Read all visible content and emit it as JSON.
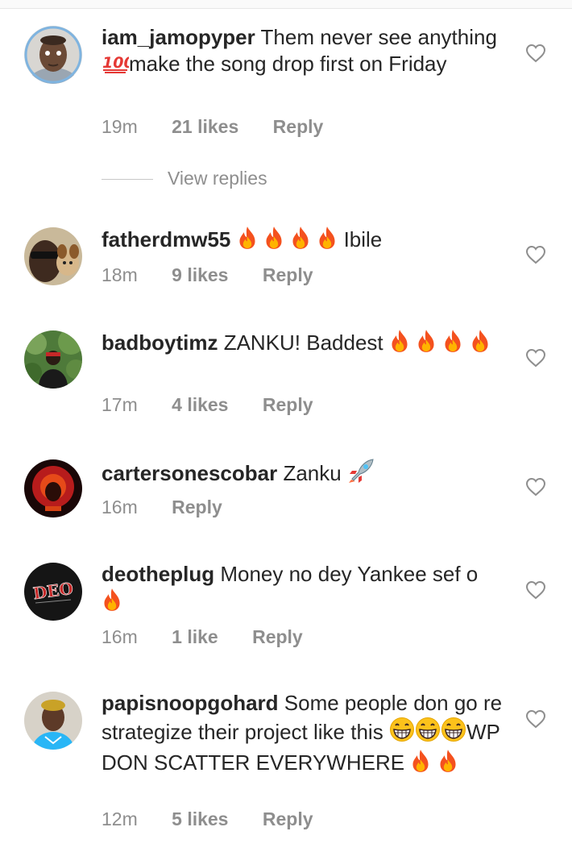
{
  "comments": [
    {
      "username": "iam_jamopyper",
      "text_parts": [
        "Them never see anything ",
        "make the song drop first on Friday"
      ],
      "time": "19m",
      "likes": "21 likes",
      "reply": "Reply",
      "avatar": "avatar-man-cartoon"
    },
    {
      "username": "fatherdmw55",
      "text_parts": [
        "Ibile"
      ],
      "time": "18m",
      "likes": "9 likes",
      "reply": "Reply",
      "avatar": "avatar-sunglasses"
    },
    {
      "username": "badboytimz",
      "text_parts": [
        "ZANKU! Baddest"
      ],
      "time": "17m",
      "likes": "4 likes",
      "reply": "Reply",
      "avatar": "avatar-forest"
    },
    {
      "username": "cartersonescobar",
      "text_parts": [
        "Zanku"
      ],
      "time": "16m",
      "reply": "Reply",
      "avatar": "avatar-red"
    },
    {
      "username": "deotheplug",
      "text_parts": [
        "Money no dey Yankee sef o"
      ],
      "time": "16m",
      "likes": "1 like",
      "reply": "Reply",
      "avatar": "avatar-deo"
    },
    {
      "username": "papisnoopgohard",
      "text_parts": [
        "Some people don go re strategize their project like this ",
        "WP DON SCATTER EVERYWHERE"
      ],
      "time": "12m",
      "likes": "5 likes",
      "reply": "Reply",
      "avatar": "avatar-blue-shirt"
    }
  ],
  "view_replies": "View replies",
  "avatar_deo_text": "DEO",
  "colors": {
    "text": "#262626",
    "muted": "#8e8e8e",
    "fire": "#f4511e"
  },
  "icons": [
    "heart-outline-icon",
    "fire-emoji",
    "hundred-points-emoji",
    "rocket-emoji",
    "grinning-emoji"
  ]
}
